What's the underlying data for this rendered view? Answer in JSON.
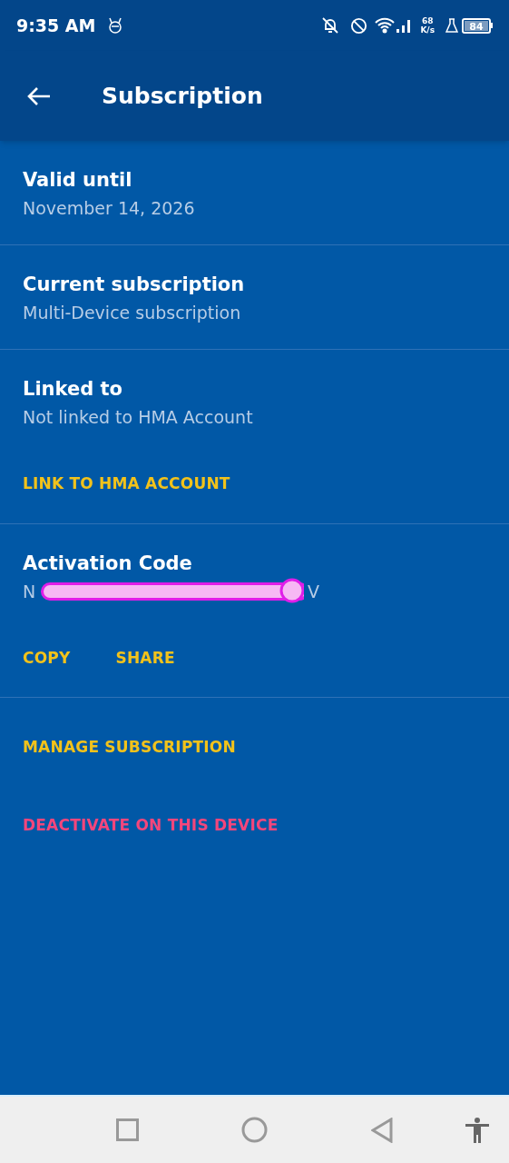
{
  "status_bar": {
    "time": "9:35 AM",
    "network_speed_value": "68",
    "network_speed_unit": "K/s",
    "battery": "84"
  },
  "header": {
    "title": "Subscription"
  },
  "sections": [
    {
      "kind": "info",
      "title": "Valid until",
      "value": "November 14, 2026"
    },
    {
      "kind": "info",
      "title": "Current subscription",
      "value": "Multi-Device subscription"
    },
    {
      "kind": "info",
      "title": "Linked to",
      "value": "Not linked to HMA Account",
      "actions": [
        {
          "label": "LINK TO HMA ACCOUNT",
          "kind": "primary"
        }
      ]
    },
    {
      "kind": "redacted",
      "title": "Activation Code",
      "value_start": "N",
      "value_end": "V",
      "actions": [
        {
          "label": "COPY",
          "kind": "primary"
        },
        {
          "label": "SHARE",
          "kind": "primary"
        }
      ]
    }
  ],
  "actions": [
    {
      "label": "MANAGE SUBSCRIPTION",
      "kind": "primary"
    },
    {
      "label": "DEACTIVATE ON THIS DEVICE",
      "kind": "danger"
    }
  ]
}
